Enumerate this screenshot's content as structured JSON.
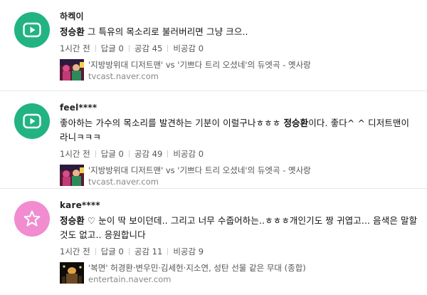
{
  "comments": [
    {
      "nickname": "하켁이",
      "text_highlight": "정승환",
      "text_rest": " 그 특유의 목소리로 불러버리면 그냥 크으..",
      "time": "1시간 전",
      "reply": "답글 0",
      "like": "공감 45",
      "dislike": "비공감 0",
      "link_title": "'지방방위대 디저트맨' vs '기쁘다 트리 오셨네'의 듀엣곡 - 옛사랑",
      "link_domain": "tvcast.naver.com"
    },
    {
      "nickname": "feel****",
      "text_before": "좋아하는 가수의 목소리를 발견하는 기분이 이럴구나ㅎㅎㅎ ",
      "text_highlight": "정승환",
      "text_after": "이다. 좋다^ ^ 디저트맨이 라니ㅋㅋㅋ",
      "time": "1시간 전",
      "reply": "답글 0",
      "like": "공감 49",
      "dislike": "비공감 0",
      "link_title": "'지방방위대 디저트맨' vs '기쁘다 트리 오셨네'의 듀엣곡 - 옛사랑",
      "link_domain": "tvcast.naver.com"
    },
    {
      "nickname": "kare****",
      "text_highlight": "정승환",
      "text_rest": " ♡ 눈이 딱 보이던데.. 그리고 너무 수줍어하는..ㅎㅎㅎ개인기도 짱 귀엽고... 음색은 말할것도 없고.. 응원합니다",
      "time": "1시간 전",
      "reply": "답글 0",
      "like": "공감 11",
      "dislike": "비공감 9",
      "link_title": "'복면' 허경환·변우민·김세헌·지소연, 성탄 선물 같은 무대 (종합)",
      "link_domain": "entertain.naver.com"
    }
  ],
  "colors": {
    "avatar_green": "#22b383",
    "avatar_pink": "#f08ccf"
  },
  "icons": {
    "tv_avatar": "play-tv-icon",
    "star_avatar": "star-icon"
  }
}
